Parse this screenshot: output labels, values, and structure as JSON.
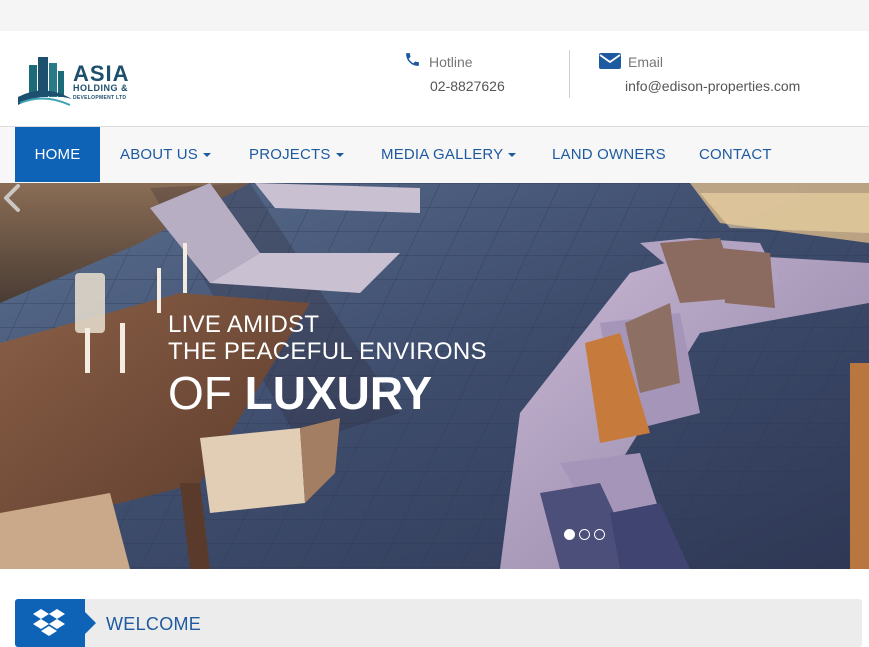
{
  "brand": {
    "name": "ASIA",
    "line2": "HOLDING &",
    "line3": "DEVELOPMENT LTD"
  },
  "contact": {
    "hotline_label": "Hotline",
    "hotline_value": "02-8827626",
    "email_label": "Email",
    "email_value": "info@edison-properties.com"
  },
  "nav": {
    "items": [
      {
        "label": "HOME",
        "active": true,
        "dropdown": false
      },
      {
        "label": "ABOUT US",
        "active": false,
        "dropdown": true
      },
      {
        "label": "PROJECTS",
        "active": false,
        "dropdown": true
      },
      {
        "label": "MEDIA GALLERY",
        "active": false,
        "dropdown": true
      },
      {
        "label": "LAND OWNERS",
        "active": false,
        "dropdown": false
      },
      {
        "label": "CONTACT",
        "active": false,
        "dropdown": false
      }
    ]
  },
  "hero": {
    "line1": "LIVE AMIDST",
    "line2": "THE PEACEFUL ENVIRONS",
    "line3_thin": "OF",
    "line3_bold": "LUXURY",
    "slide_count": 3,
    "active_slide": 1
  },
  "welcome": {
    "title": "WELCOME"
  },
  "colors": {
    "primary": "#0e63b6",
    "nav_text": "#1e5aa0",
    "logo": "#1d4f6e"
  },
  "icons": [
    "phone-icon",
    "envelope-icon",
    "chevron-left-icon",
    "dropbox-icon"
  ]
}
